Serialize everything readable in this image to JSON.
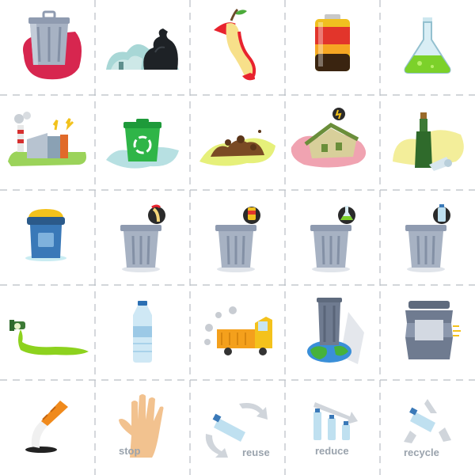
{
  "title": "",
  "labels": {
    "stop": "stop",
    "reuse": "reuse",
    "reduce": "reduce",
    "recycle": "recycle"
  },
  "colors": {
    "trash_gray": "#9aa6b8",
    "trash_dark": "#5e6a7d",
    "pink_blob": "#d7264f",
    "green": "#46b23c",
    "lime": "#8dd21e",
    "label_gray": "#9aa3ad"
  },
  "icons": [
    [
      "trash-can-on-pink-splash-icon",
      "garbage-bag-pile-icon",
      "apple-core-icon",
      "battery-icon",
      "chemical-flask-icon"
    ],
    [
      "polluting-factory-icon",
      "green-recycle-bin-icon",
      "dirt-mound-icon",
      "broken-house-icon",
      "broken-glass-bottles-icon"
    ],
    [
      "blue-lidded-bin-icon",
      "trash-can-with-apple-core-icon",
      "trash-can-with-battery-icon",
      "trash-can-with-flask-icon",
      "trash-can-with-bottle-icon"
    ],
    [
      "leaking-pipe-icon",
      "plastic-bottle-icon",
      "garbage-truck-icon",
      "trash-can-on-earth-icon",
      "compacting-trash-can-icon"
    ],
    [
      "cigarette-butt-icon",
      "stop-hand-icon",
      "reuse-bottle-icon",
      "reduce-bottles-icon",
      "recycle-bottle-icon"
    ]
  ]
}
